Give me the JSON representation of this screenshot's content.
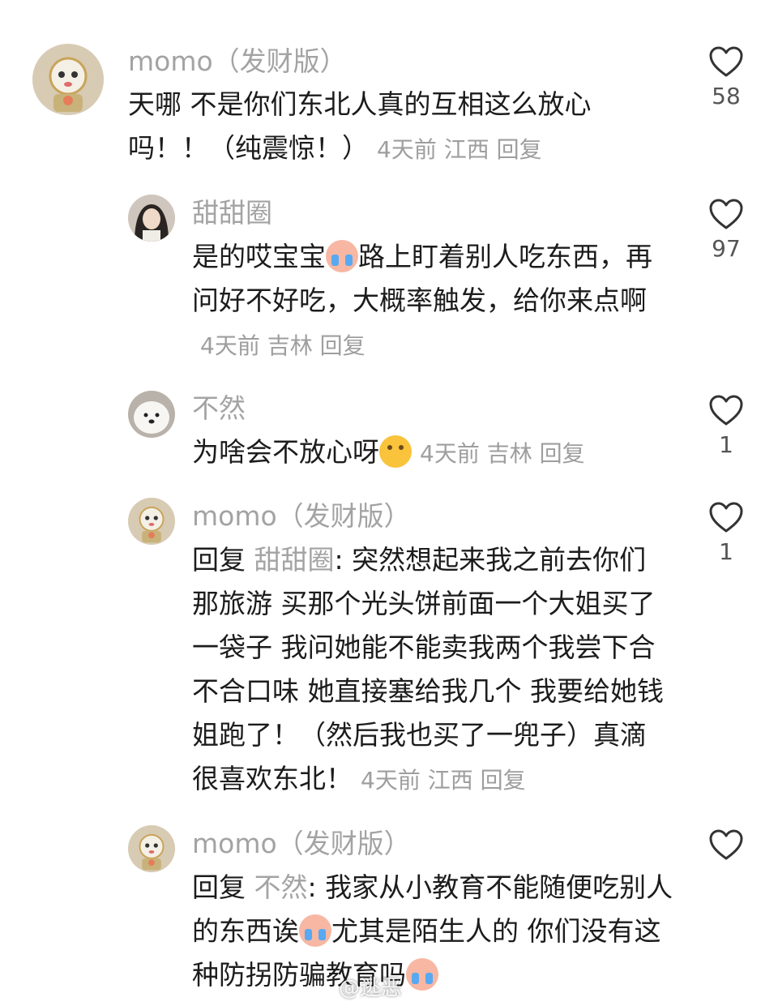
{
  "comments": [
    {
      "author": "momo（发财版）",
      "text": "天哪 不是你们东北人真的互相这么放心吗！！（纯震惊！）",
      "time": "4天前",
      "location": "江西",
      "reply_label": "回复",
      "likes": "58",
      "avatar": "cartoon-cat-avatar"
    },
    {
      "author": "甜甜圈",
      "text_before": "是的哎宝宝",
      "emoji": "crying-face-emoji",
      "text_after": "路上盯着别人吃东西，再问好不好吃，大概率触发，给你来点啊",
      "time": "4天前",
      "location": "吉林",
      "reply_label": "回复",
      "likes": "97",
      "avatar": "girl-photo-avatar"
    },
    {
      "author": "不然",
      "text_before": "为啥会不放心呀",
      "emoji": "thinking-face-emoji",
      "time": "4天前",
      "location": "吉林",
      "reply_label": "回复",
      "likes": "1",
      "avatar": "white-dog-avatar"
    },
    {
      "author": "momo（发财版）",
      "reply_prefix": "回复",
      "reply_to": "甜甜圈",
      "text": ": 突然想起来我之前去你们那旅游 买那个光头饼前面一个大姐买了一袋子 我问她能不能卖我两个我尝下合不合口味 她直接塞给我几个 我要给她钱姐跑了！（然后我也买了一兜子）真滴很喜欢东北！",
      "time": "4天前",
      "location": "江西",
      "reply_label": "回复",
      "likes": "1",
      "avatar": "cartoon-cat-avatar"
    },
    {
      "author": "momo（发财版）",
      "reply_prefix": "回复",
      "reply_to": "不然",
      "text_a": ": 我家从小教育不能随便吃别人的东西诶",
      "emoji": "crying-face-emoji",
      "text_b": "尤其是陌生人的 你们没有这种防拐防骗教育吗",
      "emoji2": "crying-face-emoji",
      "likes": "",
      "avatar": "cartoon-cat-avatar"
    }
  ],
  "watermark": "@逃恶",
  "colors": {
    "secondary_text": "#9e9e9e",
    "body_text": "#1c1c1c",
    "heart_stroke": "#333333"
  }
}
